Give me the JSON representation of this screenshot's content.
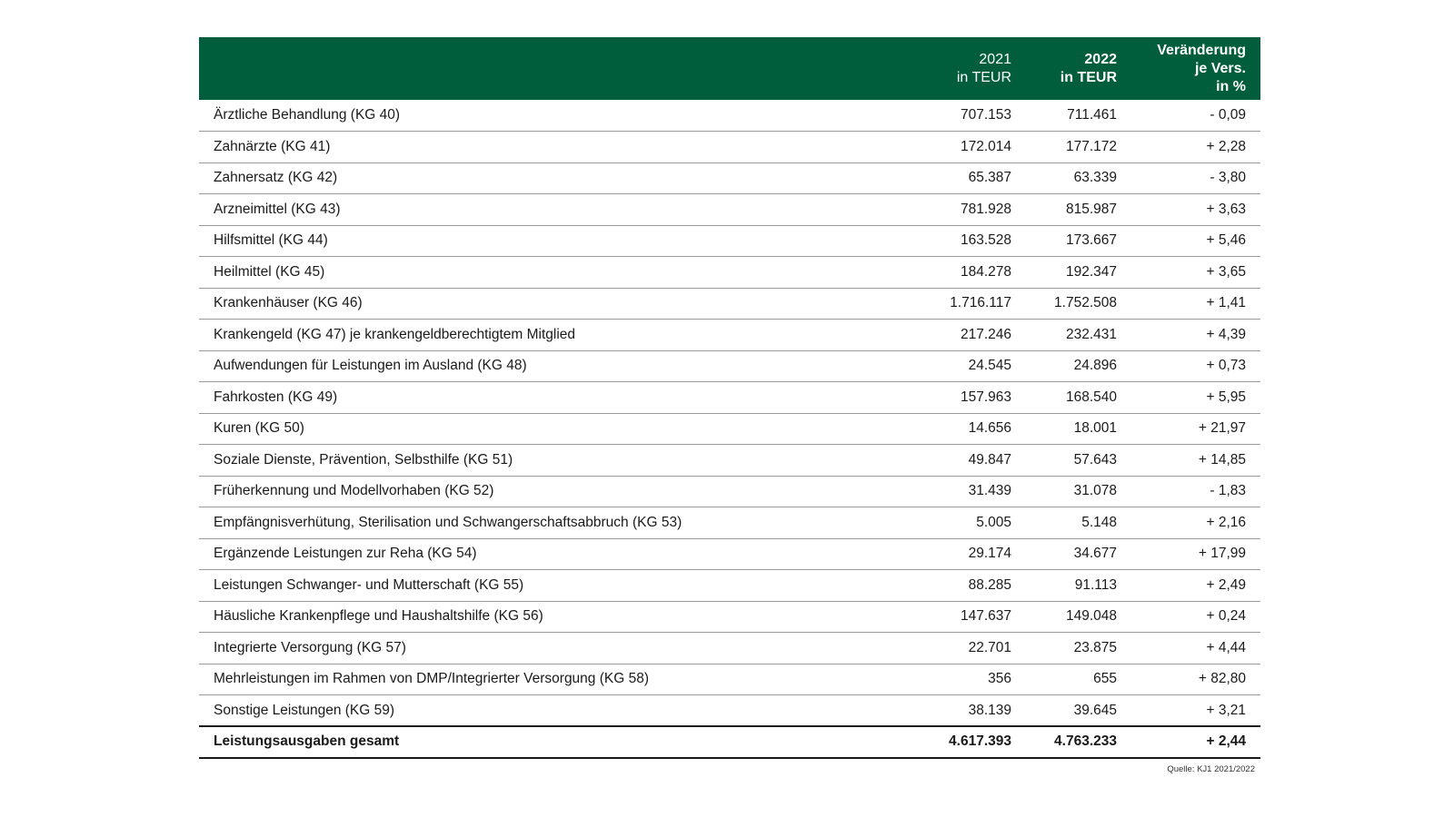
{
  "table": {
    "headers": [
      {
        "lines": [
          ""
        ]
      },
      {
        "lines": [
          "2021",
          "in TEUR"
        ],
        "bold": false
      },
      {
        "lines": [
          "2022",
          "in TEUR"
        ],
        "bold": true
      },
      {
        "lines": [
          "Veränderung",
          "je Vers.",
          "in %"
        ],
        "bold": true
      }
    ],
    "rows": [
      {
        "label": "Ärztliche Behandlung (KG 40)",
        "v2021": "707.153",
        "v2022": "711.461",
        "change": "- 0,09"
      },
      {
        "label": "Zahnärzte (KG 41)",
        "v2021": "172.014",
        "v2022": "177.172",
        "change": "+ 2,28"
      },
      {
        "label": "Zahnersatz (KG 42)",
        "v2021": "65.387",
        "v2022": "63.339",
        "change": "- 3,80"
      },
      {
        "label": "Arzneimittel (KG 43)",
        "v2021": "781.928",
        "v2022": "815.987",
        "change": "+ 3,63"
      },
      {
        "label": "Hilfsmittel (KG 44)",
        "v2021": "163.528",
        "v2022": "173.667",
        "change": "+ 5,46"
      },
      {
        "label": "Heilmittel (KG 45)",
        "v2021": "184.278",
        "v2022": "192.347",
        "change": "+ 3,65"
      },
      {
        "label": "Krankenhäuser (KG 46)",
        "v2021": "1.716.117",
        "v2022": "1.752.508",
        "change": "+ 1,41"
      },
      {
        "label": "Krankengeld (KG 47) je krankengeldberechtigtem Mitglied",
        "v2021": "217.246",
        "v2022": "232.431",
        "change": "+ 4,39"
      },
      {
        "label": "Aufwendungen für Leistungen im Ausland (KG 48)",
        "v2021": "24.545",
        "v2022": "24.896",
        "change": "+ 0,73"
      },
      {
        "label": "Fahrkosten (KG 49)",
        "v2021": "157.963",
        "v2022": "168.540",
        "change": "+ 5,95"
      },
      {
        "label": "Kuren (KG 50)",
        "v2021": "14.656",
        "v2022": "18.001",
        "change": "+ 21,97"
      },
      {
        "label": "Soziale Dienste, Prävention, Selbsthilfe (KG 51)",
        "v2021": "49.847",
        "v2022": "57.643",
        "change": "+ 14,85"
      },
      {
        "label": "Früherkennung und Modellvorhaben (KG 52)",
        "v2021": "31.439",
        "v2022": "31.078",
        "change": "- 1,83"
      },
      {
        "label": "Empfängnisverhütung, Sterilisation und Schwangerschaftsabbruch (KG 53)",
        "v2021": "5.005",
        "v2022": "5.148",
        "change": "+ 2,16"
      },
      {
        "label": "Ergänzende Leistungen zur Reha (KG 54)",
        "v2021": "29.174",
        "v2022": "34.677",
        "change": "+ 17,99"
      },
      {
        "label": "Leistungen Schwanger- und Mutterschaft (KG 55)",
        "v2021": "88.285",
        "v2022": "91.113",
        "change": "+ 2,49"
      },
      {
        "label": "Häusliche Krankenpflege und Haushaltshilfe (KG 56)",
        "v2021": "147.637",
        "v2022": "149.048",
        "change": "+ 0,24"
      },
      {
        "label": "Integrierte Versorgung (KG 57)",
        "v2021": "22.701",
        "v2022": "23.875",
        "change": "+ 4,44"
      },
      {
        "label": "Mehrleistungen im Rahmen von DMP/Integrierter Versorgung (KG 58)",
        "v2021": "356",
        "v2022": "655",
        "change": "+ 82,80"
      },
      {
        "label": "Sonstige Leistungen (KG 59)",
        "v2021": "38.139",
        "v2022": "39.645",
        "change": "+ 3,21"
      }
    ],
    "total": {
      "label": "Leistungsausgaben gesamt",
      "v2021": "4.617.393",
      "v2022": "4.763.233",
      "change": "+ 2,44"
    }
  },
  "source": "Quelle: KJ1 2021/2022",
  "colors": {
    "header_bg": "#005e3c",
    "header_text": "#ffffff",
    "row_rule": "#9a9a9a"
  }
}
